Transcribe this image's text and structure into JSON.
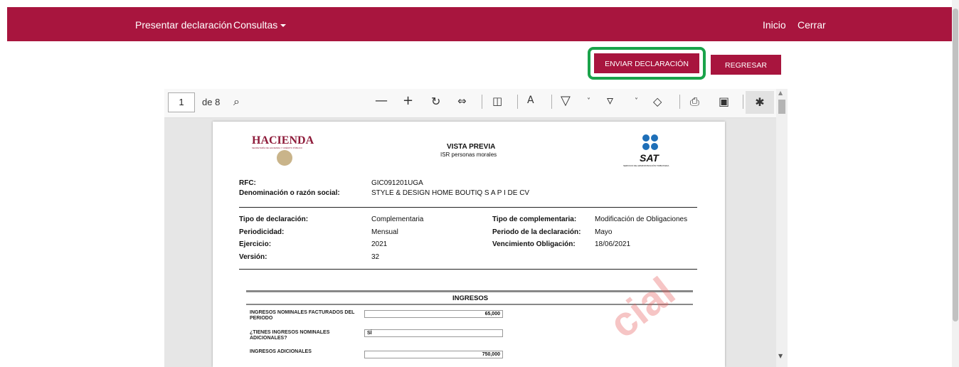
{
  "nav": {
    "presentar": "Presentar declaración",
    "consultas": "Consultas",
    "inicio": "Inicio",
    "cerrar": "Cerrar"
  },
  "actions": {
    "enviar": "ENVIAR DECLARACIÓN",
    "regresar": "REGRESAR"
  },
  "viewer": {
    "page_current": "1",
    "page_total": "de 8"
  },
  "document": {
    "hacienda": "HACIENDA",
    "hacienda_sub": "SECRETARÍA DE HACIENDA Y CRÉDITO PÚBLICO",
    "title": "VISTA PREVIA",
    "subtitle": "ISR personas morales",
    "sat": "SAT",
    "sat_sub": "SERVICIO DE ADMINISTRACIÓN TRIBUTARIA",
    "rfc_label": "RFC:",
    "rfc_value": "GIC091201UGA",
    "razon_label": "Denominación o razón social:",
    "razon_value": "STYLE & DESIGN HOME BOUTIQ S A P I DE CV",
    "tipo_label": "Tipo de declaración:",
    "tipo_value": "Complementaria",
    "tipo_comp_label": "Tipo de complementaria:",
    "tipo_comp_value": "Modificación de Obligaciones",
    "periodicidad_label": "Periodicidad:",
    "periodicidad_value": "Mensual",
    "periodo_label": "Periodo de la declaración:",
    "periodo_value": "Mayo",
    "ejercicio_label": "Ejercicio:",
    "ejercicio_value": "2021",
    "vencimiento_label": "Vencimiento Obligación:",
    "vencimiento_value": "18/06/2021",
    "version_label": "Versión:",
    "version_value": "32",
    "section": "INGRESOS",
    "row1_label": "INGRESOS NOMINALES FACTURADOS DEL PERIODO",
    "row1_value": "65,000",
    "row2_label": "¿TIENES INGRESOS NOMINALES ADICIONALES?",
    "row2_value": "SÍ",
    "row3_label": "INGRESOS ADICIONALES",
    "row3_value": "750,000",
    "watermark": "cial"
  },
  "colors": {
    "brand": "#a8153e",
    "highlight": "#1aa34a"
  }
}
